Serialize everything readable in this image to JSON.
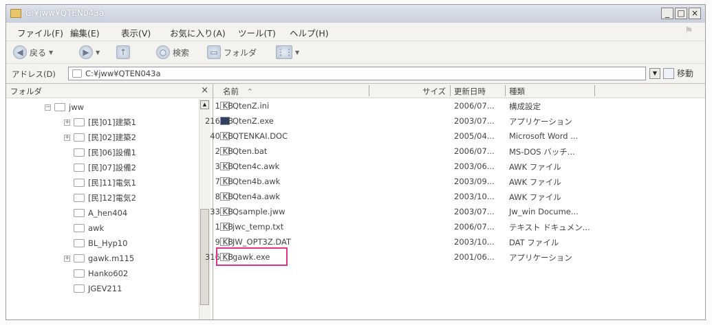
{
  "window": {
    "title": "C:¥jww¥QTEN043a",
    "controls": [
      "_",
      "□",
      "×"
    ]
  },
  "menu": [
    "ファイル(F)",
    "編集(E)",
    "表示(V)",
    "お気に入り(A)",
    "ツール(T)",
    "ヘルプ(H)"
  ],
  "toolbar": {
    "back_label": "戻る",
    "search_label": "検索",
    "folders_label": "フォルダ"
  },
  "address": {
    "label": "アドレス(D)",
    "value": "C:¥jww¥QTEN043a",
    "go_label": "移動"
  },
  "folder_pane": {
    "title": "フォルダ",
    "close": "×",
    "items": [
      {
        "label": "jww",
        "expander": "−"
      },
      {
        "label": "[民]01]建築1",
        "expander": "+"
      },
      {
        "label": "[民]02]建築2",
        "expander": "+"
      },
      {
        "label": "[民]06]設備1",
        "expander": ""
      },
      {
        "label": "[民]07]設備2",
        "expander": ""
      },
      {
        "label": "[民]11]電気1",
        "expander": ""
      },
      {
        "label": "[民]12]電気2",
        "expander": ""
      },
      {
        "label": "A_hen404",
        "expander": ""
      },
      {
        "label": "awk",
        "expander": ""
      },
      {
        "label": "BL_Hyp10",
        "expander": ""
      },
      {
        "label": "gawk.m115",
        "expander": "+"
      },
      {
        "label": "Hanko602",
        "expander": ""
      },
      {
        "label": "JGEV211",
        "expander": ""
      }
    ]
  },
  "file_list": {
    "columns": {
      "name": "名前",
      "size": "サイズ",
      "date": "更新日時",
      "type": "種類"
    },
    "rows": [
      {
        "name": "QtenZ.ini",
        "size": "1 KB",
        "date": "2006/07...",
        "type": "構成設定",
        "icon": "settings-file-icon"
      },
      {
        "name": "QtenZ.exe",
        "size": "216 KB",
        "date": "2003/07...",
        "type": "アプリケーション",
        "icon": "application-icon"
      },
      {
        "name": "QTENKAI.DOC",
        "size": "40 KB",
        "date": "2005/04...",
        "type": "Microsoft Word ...",
        "icon": "word-doc-icon"
      },
      {
        "name": "Qten.bat",
        "size": "2 KB",
        "date": "2006/07...",
        "type": "MS-DOS バッチ...",
        "icon": "batch-file-icon"
      },
      {
        "name": "Qten4c.awk",
        "size": "3 KB",
        "date": "2003/06...",
        "type": "AWK ファイル",
        "icon": "awk-file-icon"
      },
      {
        "name": "Qten4b.awk",
        "size": "7 KB",
        "date": "2003/09...",
        "type": "AWK ファイル",
        "icon": "awk-file-icon"
      },
      {
        "name": "Qten4a.awk",
        "size": "8 KB",
        "date": "2003/10...",
        "type": "AWK ファイル",
        "icon": "awk-file-icon"
      },
      {
        "name": "Qsample.jww",
        "size": "33 KB",
        "date": "2003/07...",
        "type": "Jw_win Docume...",
        "icon": "jww-file-icon"
      },
      {
        "name": "jwc_temp.txt",
        "size": "1 KB",
        "date": "2006/07...",
        "type": "テキスト ドキュメン...",
        "icon": "text-file-icon"
      },
      {
        "name": "JW_OPT3Z.DAT",
        "size": "9 KB",
        "date": "2003/10...",
        "type": "DAT ファイル",
        "icon": "dat-file-icon"
      },
      {
        "name": "gawk.exe",
        "size": "316 KB",
        "date": "2001/06...",
        "type": "アプリケーション",
        "icon": "application-icon"
      }
    ]
  },
  "highlight_color": "#e2318a"
}
